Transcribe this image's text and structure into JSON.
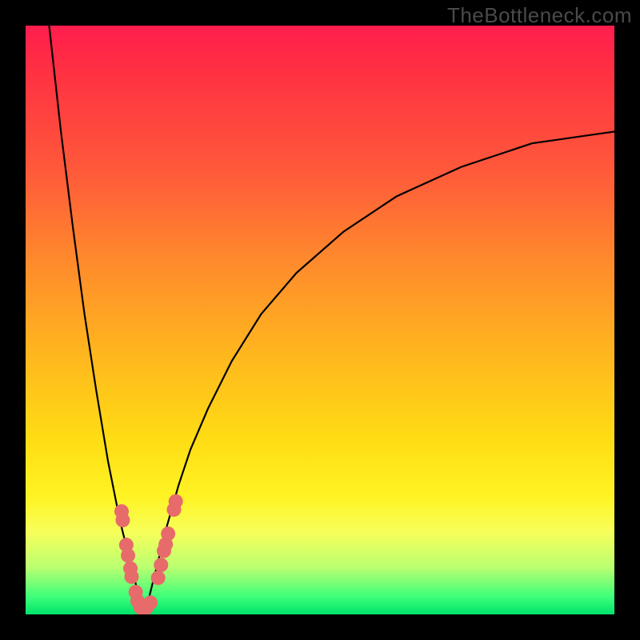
{
  "watermark": "TheBottleneck.com",
  "chart_data": {
    "type": "line",
    "title": "",
    "xlabel": "",
    "ylabel": "",
    "xlim": [
      0,
      100
    ],
    "ylim": [
      0,
      100
    ],
    "series": [
      {
        "name": "curve-left",
        "x": [
          4,
          6,
          8,
          10,
          12,
          14,
          15,
          16,
          17,
          18,
          19,
          19.5
        ],
        "y": [
          100,
          82,
          66,
          51,
          38,
          26,
          21,
          16,
          12,
          8,
          4,
          1
        ]
      },
      {
        "name": "curve-right",
        "x": [
          20.5,
          21,
          22,
          23,
          24,
          26,
          28,
          31,
          35,
          40,
          46,
          54,
          63,
          74,
          86,
          100
        ],
        "y": [
          1,
          3,
          7,
          11,
          15,
          22,
          28,
          35,
          43,
          51,
          58,
          65,
          71,
          76,
          80,
          82
        ]
      }
    ],
    "markers": {
      "name": "highlight-dots",
      "color": "#e76b6b",
      "radius_px": 9,
      "points": [
        {
          "x": 16.3,
          "y": 17.5
        },
        {
          "x": 16.5,
          "y": 16.0
        },
        {
          "x": 17.1,
          "y": 11.8
        },
        {
          "x": 17.4,
          "y": 10.0
        },
        {
          "x": 17.8,
          "y": 7.8
        },
        {
          "x": 18.0,
          "y": 6.4
        },
        {
          "x": 18.7,
          "y": 3.8
        },
        {
          "x": 19.0,
          "y": 2.3
        },
        {
          "x": 19.5,
          "y": 1.2
        },
        {
          "x": 20.0,
          "y": 0.9
        },
        {
          "x": 20.5,
          "y": 1.1
        },
        {
          "x": 21.2,
          "y": 2.0
        },
        {
          "x": 22.5,
          "y": 6.2
        },
        {
          "x": 23.0,
          "y": 8.4
        },
        {
          "x": 23.5,
          "y": 10.8
        },
        {
          "x": 23.8,
          "y": 11.9
        },
        {
          "x": 24.2,
          "y": 13.7
        },
        {
          "x": 25.2,
          "y": 17.8
        },
        {
          "x": 25.5,
          "y": 19.2
        }
      ]
    }
  }
}
